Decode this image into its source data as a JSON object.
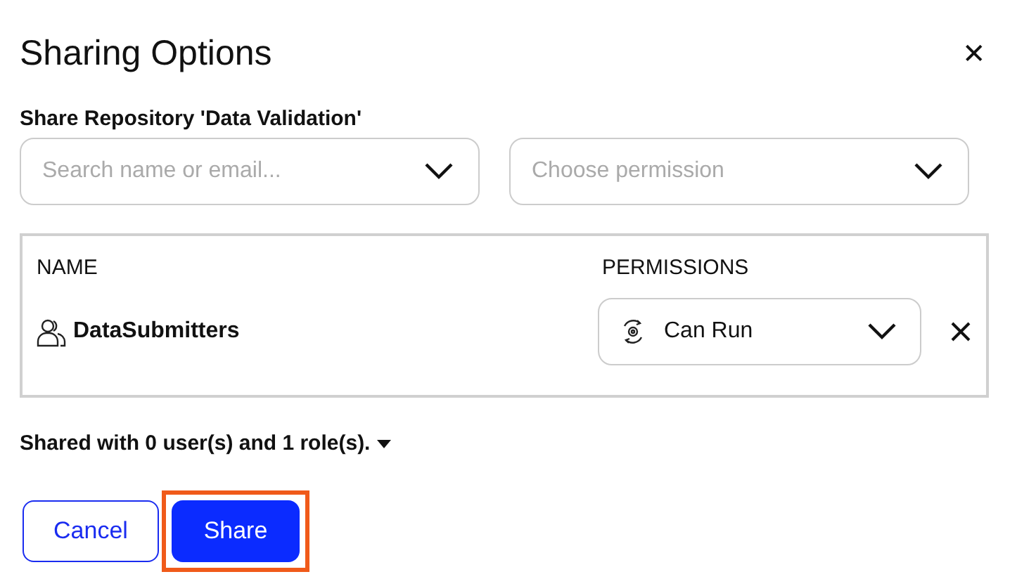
{
  "dialog": {
    "title": "Sharing Options",
    "close_icon": "✕"
  },
  "form": {
    "label": "Share Repository 'Data Validation'",
    "user_search": {
      "placeholder": "Search name or email..."
    },
    "permission_select": {
      "placeholder": "Choose permission"
    }
  },
  "table": {
    "columns": [
      "NAME",
      "PERMISSIONS"
    ],
    "rows": [
      {
        "name": "DataSubmitters",
        "permission": "Can Run"
      }
    ]
  },
  "summary": "Shared with 0 user(s) and 1 role(s).",
  "buttons": [
    {
      "label": "Cancel",
      "kind": "secondary",
      "highlighted": false
    },
    {
      "label": "Share",
      "kind": "primary",
      "highlighted": true
    }
  ]
}
